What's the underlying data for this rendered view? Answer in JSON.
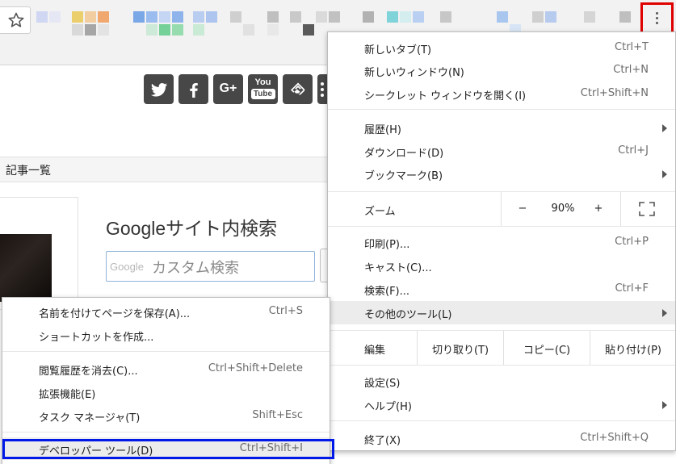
{
  "main_menu": {
    "new_tab": {
      "label": "新しいタブ(T)",
      "shortcut": "Ctrl+T"
    },
    "new_window": {
      "label": "新しいウィンドウ(N)",
      "shortcut": "Ctrl+N"
    },
    "incognito": {
      "label": "シークレット ウィンドウを開く(I)",
      "shortcut": "Ctrl+Shift+N"
    },
    "history": {
      "label": "履歴(H)"
    },
    "downloads": {
      "label": "ダウンロード(D)",
      "shortcut": "Ctrl+J"
    },
    "bookmarks": {
      "label": "ブックマーク(B)"
    },
    "zoom": {
      "label": "ズーム",
      "minus": "−",
      "value": "90%",
      "plus": "+"
    },
    "print": {
      "label": "印刷(P)...",
      "shortcut": "Ctrl+P"
    },
    "cast": {
      "label": "キャスト(C)..."
    },
    "find": {
      "label": "検索(F)...",
      "shortcut": "Ctrl+F"
    },
    "more_tools": {
      "label": "その他のツール(L)"
    },
    "edit": {
      "label": "編集",
      "cut": "切り取り(T)",
      "copy": "コピー(C)",
      "paste": "貼り付け(P)"
    },
    "settings": {
      "label": "設定(S)"
    },
    "help": {
      "label": "ヘルプ(H)"
    },
    "exit": {
      "label": "終了(X)",
      "shortcut": "Ctrl+Shift+Q"
    }
  },
  "sub_menu": {
    "save_page": {
      "label": "名前を付けてページを保存(A)...",
      "shortcut": "Ctrl+S"
    },
    "create_shortcut": {
      "label": "ショートカットを作成..."
    },
    "clear_data": {
      "label": "閲覧履歴を消去(C)...",
      "shortcut": "Ctrl+Shift+Delete"
    },
    "extensions": {
      "label": "拡張機能(E)"
    },
    "task_manager": {
      "label": "タスク マネージャ(T)",
      "shortcut": "Shift+Esc"
    },
    "dev_tools": {
      "label": "デベロッパー ツール(D)",
      "shortcut": "Ctrl+Shift+I"
    }
  },
  "page": {
    "nav_label": "記事一覧",
    "search_title": "Googleサイト内検索",
    "search_google_mark": "Google",
    "search_placeholder": "カスタム検索",
    "social": {
      "gplus": "G+",
      "youtube_top": "You",
      "youtube_bottom": "Tube"
    }
  },
  "colors": {
    "highlight_red": "#e00000",
    "highlight_blue": "#0018e8",
    "social_gray": "#474747"
  }
}
